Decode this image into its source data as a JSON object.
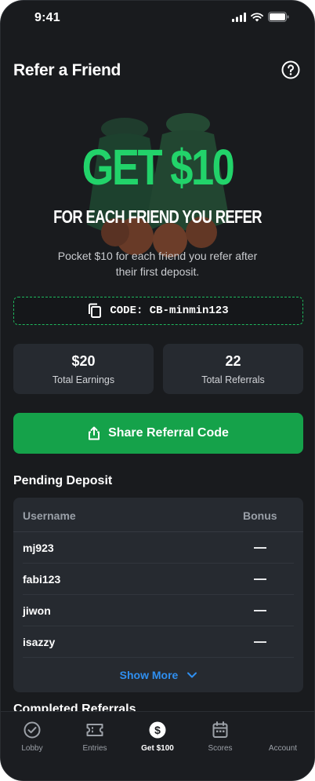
{
  "status_bar": {
    "time": "9:41"
  },
  "header": {
    "title": "Refer a Friend"
  },
  "hero": {
    "amount": "GET $10",
    "subtitle": "FOR EACH FRIEND YOU REFER",
    "description": "Pocket $10 for each friend you refer after their first deposit.",
    "accent_color": "#22d36a"
  },
  "code": {
    "label": "CODE: CB-minmin123"
  },
  "stats": [
    {
      "value": "$20",
      "label": "Total Earnings"
    },
    {
      "value": "22",
      "label": "Total Referrals"
    }
  ],
  "share": {
    "label": "Share Referral Code",
    "color": "#15a24a"
  },
  "pending": {
    "title": "Pending Deposit",
    "columns": [
      "Username",
      "Bonus"
    ],
    "rows": [
      {
        "username": "mj923",
        "bonus": "—"
      },
      {
        "username": "fabi123",
        "bonus": "—"
      },
      {
        "username": "jiwon",
        "bonus": "—"
      },
      {
        "username": "isazzy",
        "bonus": "—"
      }
    ],
    "show_more": "Show More"
  },
  "completed": {
    "title": "Completed Referrals"
  },
  "tabs": [
    {
      "label": "Lobby",
      "icon": "check-circle-icon",
      "active": false
    },
    {
      "label": "Entries",
      "icon": "ticket-icon",
      "active": false
    },
    {
      "label": "Get $100",
      "icon": "dollar-circle-icon",
      "active": true
    },
    {
      "label": "Scores",
      "icon": "calendar-icon",
      "active": false
    },
    {
      "label": "Account",
      "icon": "account-icon",
      "active": false
    }
  ]
}
